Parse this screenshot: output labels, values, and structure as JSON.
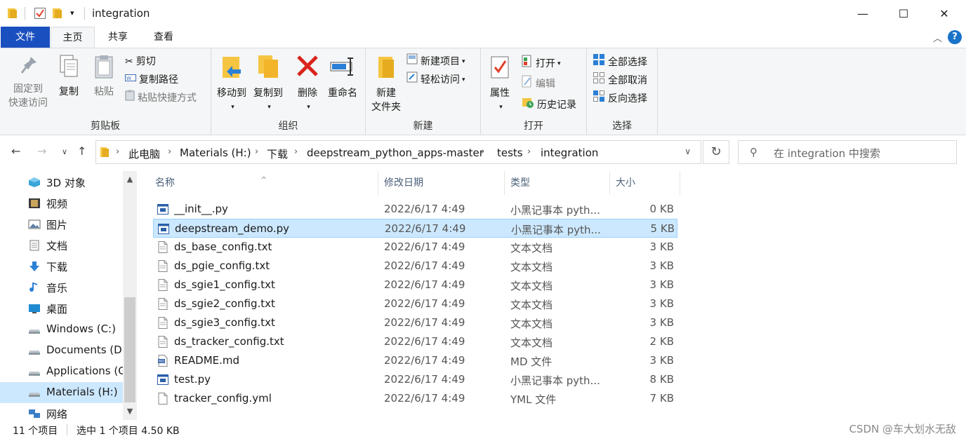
{
  "window": {
    "title": "integration",
    "minimize": "—",
    "maximize": "☐",
    "close": "✕"
  },
  "tabs": {
    "file": "文件",
    "home": "主页",
    "share": "共享",
    "view": "查看",
    "help": "?"
  },
  "ribbon": {
    "clipboard": {
      "label": "剪贴板",
      "pin_line1": "固定到",
      "pin_line2": "快速访问",
      "copy": "复制",
      "paste": "粘贴",
      "cut": "剪切",
      "copy_path": "复制路径",
      "paste_shortcut": "粘贴快捷方式"
    },
    "organize": {
      "label": "组织",
      "move_to": "移动到",
      "copy_to": "复制到",
      "delete": "删除",
      "rename": "重命名"
    },
    "new": {
      "label": "新建",
      "new_folder_line1": "新建",
      "new_folder_line2": "文件夹",
      "new_item": "新建项目",
      "easy_access": "轻松访问"
    },
    "open": {
      "label": "打开",
      "properties": "属性",
      "open": "打开",
      "edit": "编辑",
      "history": "历史记录"
    },
    "select": {
      "label": "选择",
      "select_all": "全部选择",
      "select_none": "全部取消",
      "invert": "反向选择"
    }
  },
  "address": {
    "breadcrumbs": [
      "此电脑",
      "Materials (H:)",
      "下载",
      "deepstream_python_apps-master",
      "tests",
      "integration"
    ],
    "search_placeholder": "在 integration 中搜索"
  },
  "nav_pane": {
    "items": [
      {
        "label": "3D 对象",
        "icon": "3d-objects-icon"
      },
      {
        "label": "视频",
        "icon": "videos-icon"
      },
      {
        "label": "图片",
        "icon": "pictures-icon"
      },
      {
        "label": "文档",
        "icon": "documents-icon"
      },
      {
        "label": "下载",
        "icon": "downloads-icon"
      },
      {
        "label": "音乐",
        "icon": "music-icon"
      },
      {
        "label": "桌面",
        "icon": "desktop-icon"
      },
      {
        "label": "Windows (C:)",
        "icon": "drive-icon"
      },
      {
        "label": "Documents (D:)",
        "icon": "drive-icon"
      },
      {
        "label": "Applications (G:)",
        "icon": "drive-icon"
      },
      {
        "label": "Materials (H:)",
        "icon": "drive-icon",
        "selected": true
      },
      {
        "label": "网络",
        "icon": "network-icon"
      }
    ]
  },
  "columns": {
    "name": "名称",
    "date": "修改日期",
    "type": "类型",
    "size": "大小"
  },
  "files": [
    {
      "name": "__init__.py",
      "date": "2022/6/17 4:49",
      "type": "小黑记事本 pyth...",
      "size": "0 KB",
      "icon": "python-file-icon"
    },
    {
      "name": "deepstream_demo.py",
      "date": "2022/6/17 4:49",
      "type": "小黑记事本 pyth...",
      "size": "5 KB",
      "icon": "python-file-icon",
      "selected": true
    },
    {
      "name": "ds_base_config.txt",
      "date": "2022/6/17 4:49",
      "type": "文本文档",
      "size": "3 KB",
      "icon": "text-file-icon"
    },
    {
      "name": "ds_pgie_config.txt",
      "date": "2022/6/17 4:49",
      "type": "文本文档",
      "size": "3 KB",
      "icon": "text-file-icon"
    },
    {
      "name": "ds_sgie1_config.txt",
      "date": "2022/6/17 4:49",
      "type": "文本文档",
      "size": "3 KB",
      "icon": "text-file-icon"
    },
    {
      "name": "ds_sgie2_config.txt",
      "date": "2022/6/17 4:49",
      "type": "文本文档",
      "size": "3 KB",
      "icon": "text-file-icon"
    },
    {
      "name": "ds_sgie3_config.txt",
      "date": "2022/6/17 4:49",
      "type": "文本文档",
      "size": "3 KB",
      "icon": "text-file-icon"
    },
    {
      "name": "ds_tracker_config.txt",
      "date": "2022/6/17 4:49",
      "type": "文本文档",
      "size": "2 KB",
      "icon": "text-file-icon"
    },
    {
      "name": "README.md",
      "date": "2022/6/17 4:49",
      "type": "MD 文件",
      "size": "3 KB",
      "icon": "markdown-file-icon"
    },
    {
      "name": "test.py",
      "date": "2022/6/17 4:49",
      "type": "小黑记事本 pyth...",
      "size": "8 KB",
      "icon": "python-file-icon"
    },
    {
      "name": "tracker_config.yml",
      "date": "2022/6/17 4:49",
      "type": "YML 文件",
      "size": "7 KB",
      "icon": "generic-file-icon"
    }
  ],
  "status": {
    "count": "11 个项目",
    "selection": "选中 1 个项目  4.50 KB",
    "watermark": "CSDN @车大划水无敌"
  },
  "colors": {
    "accent": "#1a4fbf",
    "selection": "#cce8ff",
    "selection_border": "#99d1ff"
  }
}
